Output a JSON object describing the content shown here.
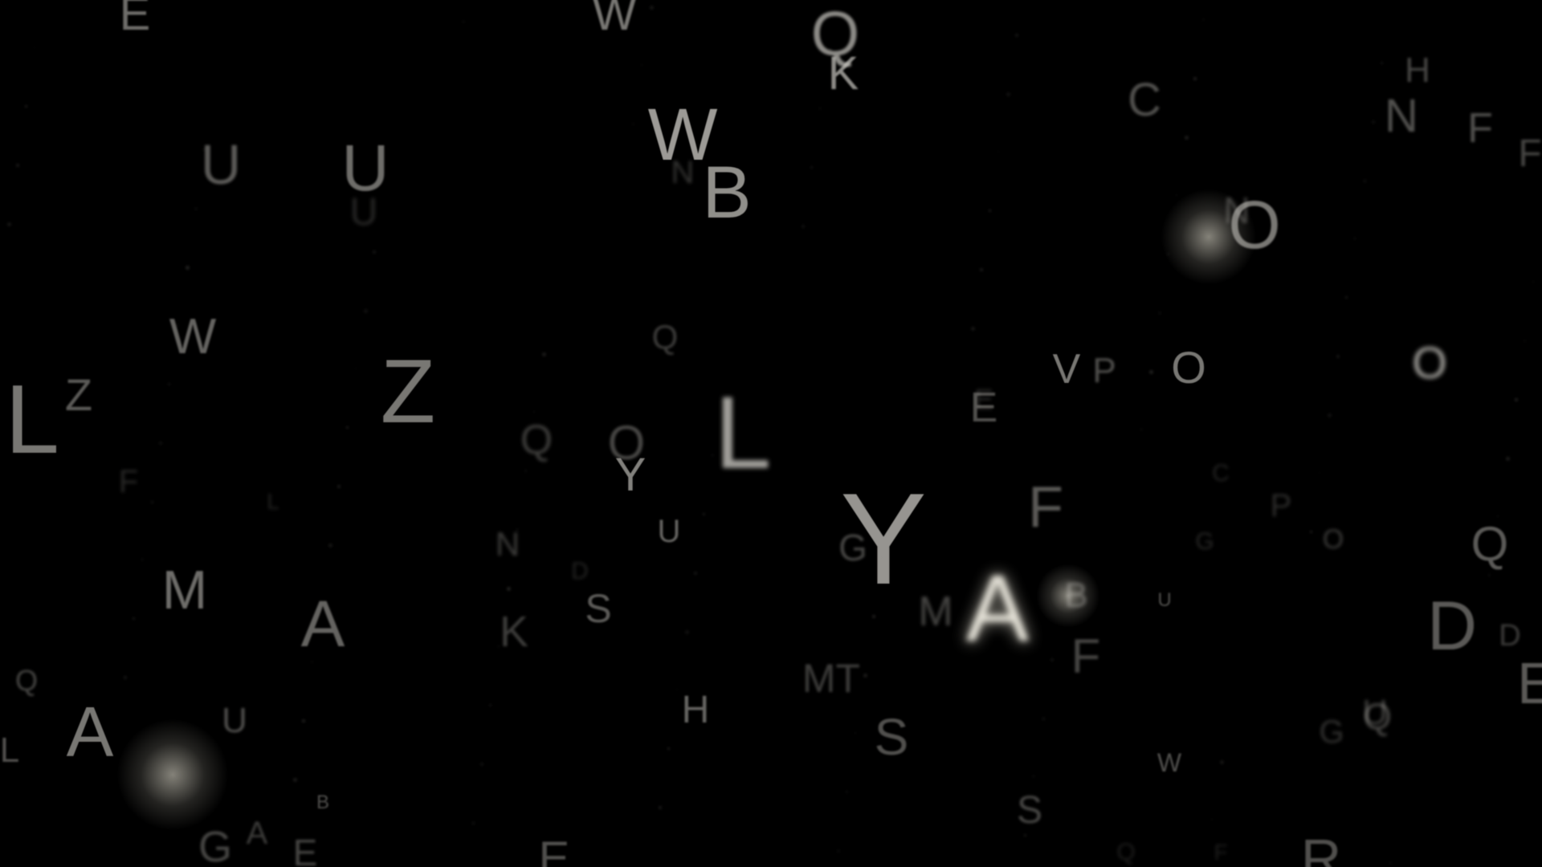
{
  "background_color": "#000000",
  "letter_color": "#c8c6c0",
  "glow_color": "#f2efe4",
  "letters": [
    "E",
    "W",
    "Q",
    "K",
    "U",
    "U",
    "W",
    "B",
    "N",
    "H",
    "C",
    "F",
    "N",
    "F",
    "O",
    "N",
    "W",
    "Z",
    "L",
    "Z",
    "Q",
    "L",
    "Q",
    "O",
    "Y",
    "E",
    "V",
    "P",
    "O",
    "O",
    "Y",
    "F",
    "U",
    "G",
    "M",
    "A",
    "N",
    "S",
    "K",
    "A",
    "M",
    "F",
    "B",
    "U",
    "Q",
    "D",
    "Q",
    "O",
    "H",
    "D",
    "A",
    "U",
    "L",
    "MT",
    "S",
    "E",
    "Q",
    "B",
    "G",
    "U",
    "W",
    "S",
    "G",
    "A",
    "E",
    "E",
    "R",
    "E",
    "P",
    "F",
    "U",
    "Q",
    "F",
    "D",
    "C",
    "L",
    "G"
  ]
}
